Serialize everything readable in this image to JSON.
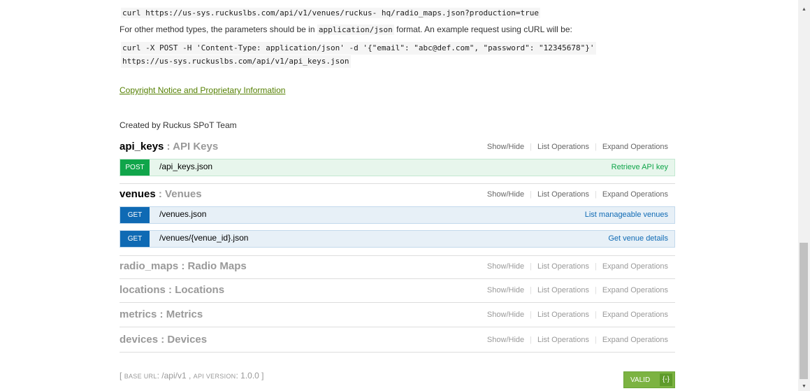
{
  "doc": {
    "curl_get": "curl https://us-sys.ruckuslbs.com/api/v1/venues/ruckus- hq/radio_maps.json?production=true",
    "other_methods_prefix": "For other method types, the parameters should be in",
    "content_type": "application/json",
    "other_methods_suffix": "format. An example request using cURL will be:",
    "curl_post_line1": "curl -X POST -H 'Content-Type: application/json' -d '{\"email\": \"abc@def.com\", \"password\": \"12345678\"}'",
    "curl_post_line2": "https://us-sys.ruckuslbs.com/api/v1/api_keys.json",
    "copyright_link": "Copyright Notice and Proprietary Information",
    "created_by": "Created by Ruckus SPoT Team"
  },
  "ops_labels": {
    "show_hide": "Show/Hide",
    "list_operations": "List Operations",
    "expand_operations": "Expand Operations"
  },
  "resources": [
    {
      "name": "api_keys",
      "sep": " : ",
      "desc": "API Keys"
    },
    {
      "name": "venues",
      "sep": " : ",
      "desc": "Venues"
    },
    {
      "name": "radio_maps",
      "sep": " : ",
      "desc": "Radio Maps"
    },
    {
      "name": "locations",
      "sep": " : ",
      "desc": "Locations"
    },
    {
      "name": "metrics",
      "sep": " : ",
      "desc": "Metrics"
    },
    {
      "name": "devices",
      "sep": " : ",
      "desc": "Devices"
    }
  ],
  "endpoints": [
    {
      "method": "POST",
      "path": "/api_keys.json",
      "summary": "Retrieve API key"
    },
    {
      "method": "GET",
      "path": "/venues.json",
      "summary": "List manageable venues"
    },
    {
      "method": "GET",
      "path": "/venues/{venue_id}.json",
      "summary": "Get venue details"
    }
  ],
  "footer": {
    "open_bracket": "[",
    "base_url_label": "BASE URL",
    "base_url": ": /api/v1 ,",
    "api_version_label": "API VERSION",
    "api_version": ": 1.0.0 ]"
  },
  "valid_badge": {
    "label": "VALID",
    "icon": "{-}"
  },
  "colors": {
    "post": "#10a54a",
    "get": "#0f6ab4",
    "link": "#547f00",
    "valid": "#7cb342"
  }
}
